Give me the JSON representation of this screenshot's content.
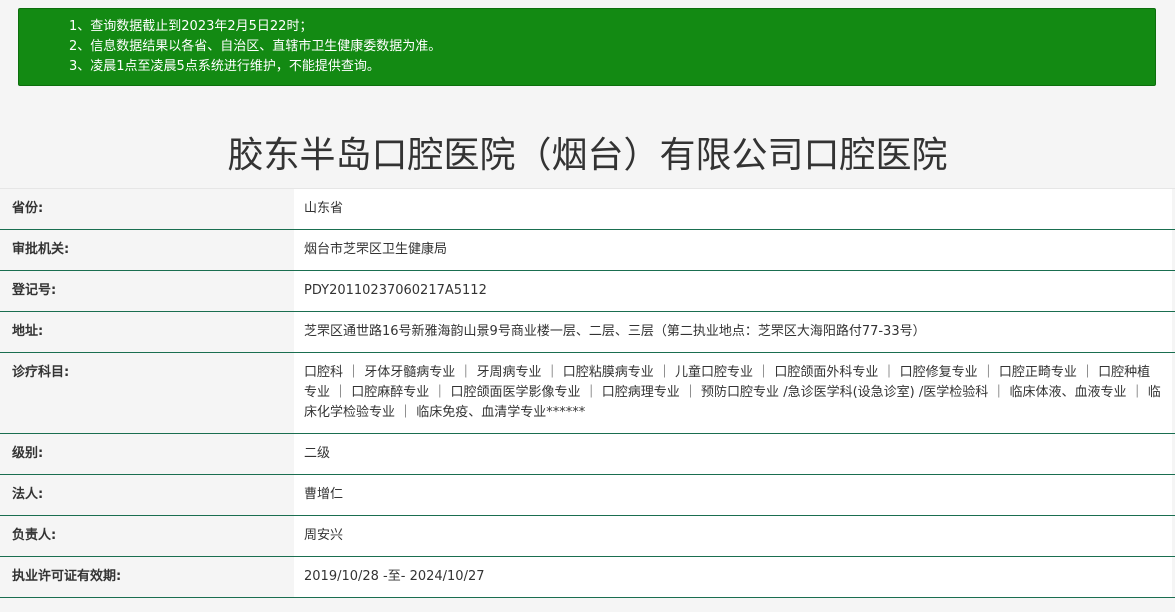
{
  "notice": {
    "lines": [
      "1、查询数据截止到2023年2月5日22时；",
      "2、信息数据结果以各省、自治区、直辖市卫生健康委数据为准。",
      "3、凌晨1点至凌晨5点系统进行维护，不能提供查询。"
    ]
  },
  "title": "胶东半岛口腔医院（烟台）有限公司口腔医院",
  "rows": [
    {
      "label": "省份:",
      "value": "山东省"
    },
    {
      "label": "审批机关:",
      "value": "烟台市芝罘区卫生健康局"
    },
    {
      "label": "登记号:",
      "value": "PDY20110237060217A5112"
    },
    {
      "label": "地址:",
      "value": "芝罘区通世路16号新雅海韵山景9号商业楼一层、二层、三层（第二执业地点：芝罘区大海阳路付77-33号）"
    },
    {
      "label": "诊疗科目:",
      "value": "口腔科 ｜ 牙体牙髓病专业 ｜ 牙周病专业 ｜ 口腔粘膜病专业 ｜ 儿童口腔专业 ｜ 口腔颌面外科专业 ｜ 口腔修复专业 ｜ 口腔正畸专业 ｜ 口腔种植专业 ｜ 口腔麻醉专业 ｜ 口腔颌面医学影像专业 ｜ 口腔病理专业 ｜ 预防口腔专业 /急诊医学科(设急诊室) /医学检验科 ｜ 临床体液、血液专业 ｜ 临床化学检验专业 ｜ 临床免疫、血清学专业******"
    },
    {
      "label": "级别:",
      "value": "二级"
    },
    {
      "label": "法人:",
      "value": "曹增仁"
    },
    {
      "label": "负责人:",
      "value": "周安兴"
    },
    {
      "label": "执业许可证有效期:",
      "value": "2019/10/28 -至- 2024/10/27"
    }
  ],
  "colors": {
    "notice_bg": "#138a13",
    "row_border": "#1a6e50"
  }
}
